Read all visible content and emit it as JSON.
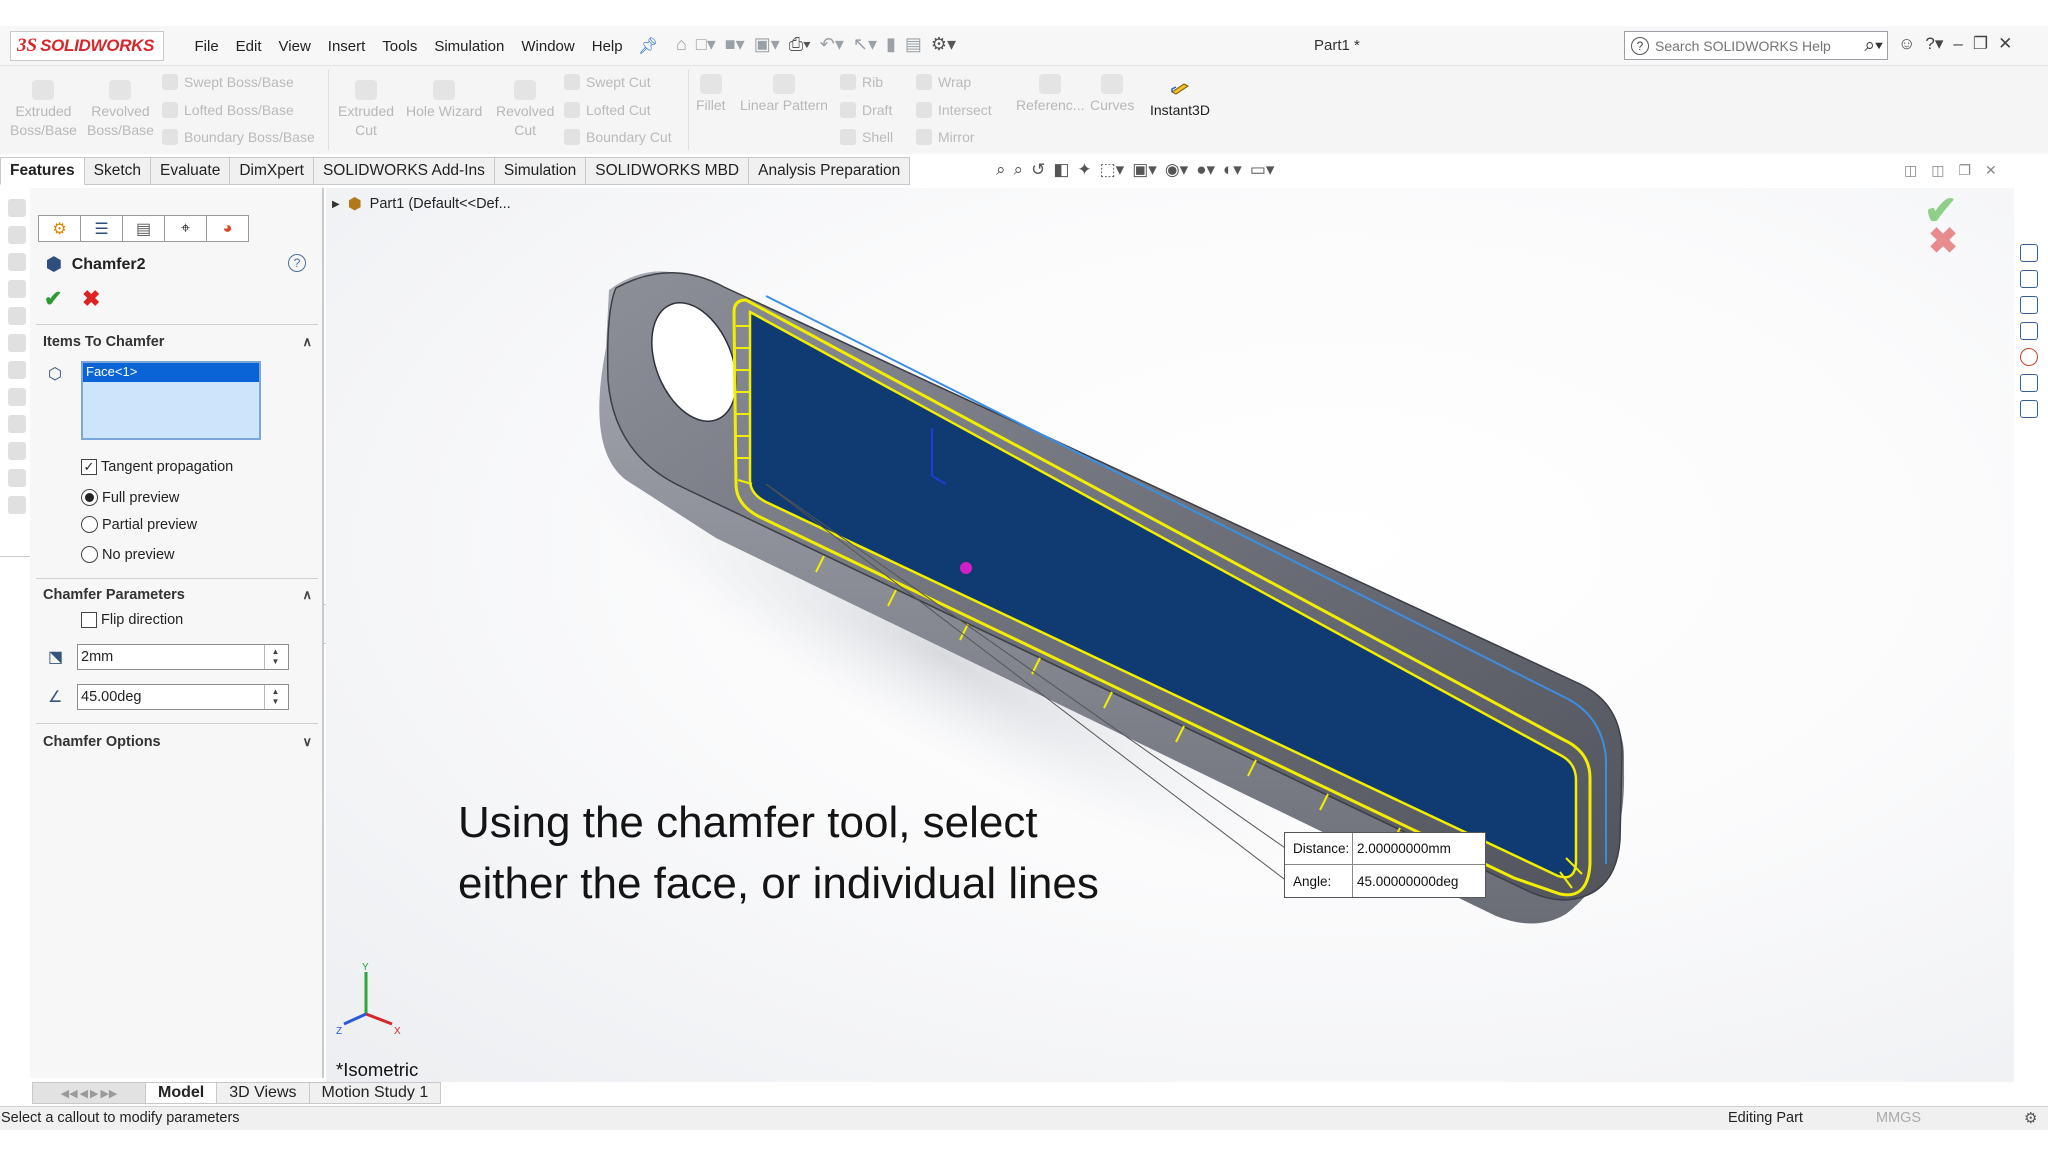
{
  "app": {
    "logo_text": "SOLIDWORKS",
    "document_title": "Part1 *"
  },
  "menu": [
    "File",
    "Edit",
    "View",
    "Insert",
    "Tools",
    "Simulation",
    "Window",
    "Help"
  ],
  "search": {
    "placeholder": "Search SOLIDWORKS Help"
  },
  "commands": {
    "extruded_boss": [
      "Extruded",
      "Boss/Base"
    ],
    "revolved_boss": [
      "Revolved",
      "Boss/Base"
    ],
    "swept_boss": "Swept Boss/Base",
    "lofted_boss": "Lofted Boss/Base",
    "boundary_boss": "Boundary Boss/Base",
    "extruded_cut": [
      "Extruded",
      "Cut"
    ],
    "hole_wizard": "Hole Wizard",
    "revolved_cut": [
      "Revolved",
      "Cut"
    ],
    "swept_cut": "Swept Cut",
    "lofted_cut": "Lofted Cut",
    "boundary_cut": "Boundary Cut",
    "fillet": "Fillet",
    "linear_pattern": "Linear Pattern",
    "rib": "Rib",
    "draft": "Draft",
    "shell": "Shell",
    "wrap": "Wrap",
    "intersect": "Intersect",
    "mirror": "Mirror",
    "reference": "Referenc...",
    "curves": "Curves",
    "instant3d": "Instant3D"
  },
  "tabs": [
    "Features",
    "Sketch",
    "Evaluate",
    "DimXpert",
    "SOLIDWORKS Add-Ins",
    "Simulation",
    "SOLIDWORKS MBD",
    "Analysis Preparation"
  ],
  "property_manager": {
    "feature_name": "Chamfer2",
    "items_header": "Items To Chamfer",
    "selected_item": "Face<1>",
    "tangent_propagation": "Tangent propagation",
    "full_preview": "Full preview",
    "partial_preview": "Partial preview",
    "no_preview": "No preview",
    "params_header": "Chamfer Parameters",
    "flip_direction": "Flip direction",
    "distance_value": "2mm",
    "angle_value": "45.00deg",
    "options_header": "Chamfer Options"
  },
  "viewport": {
    "tree_item": "Part1  (Default<<Def...",
    "caption_line1": "Using the chamfer tool, select",
    "caption_line2": "either the face, or individual lines",
    "view_label": "*Isometric",
    "callout": {
      "distance_label": "Distance:",
      "distance_value": "2.00000000mm",
      "angle_label": "Angle:",
      "angle_value": "45.00000000deg"
    },
    "triad": {
      "y": "Y",
      "z": "Z",
      "x": "X"
    }
  },
  "bottom_tabs": [
    "Model",
    "3D Views",
    "Motion Study 1"
  ],
  "status": {
    "message": "Select a callout to modify parameters",
    "mode": "Editing Part",
    "units": "MMGS"
  }
}
